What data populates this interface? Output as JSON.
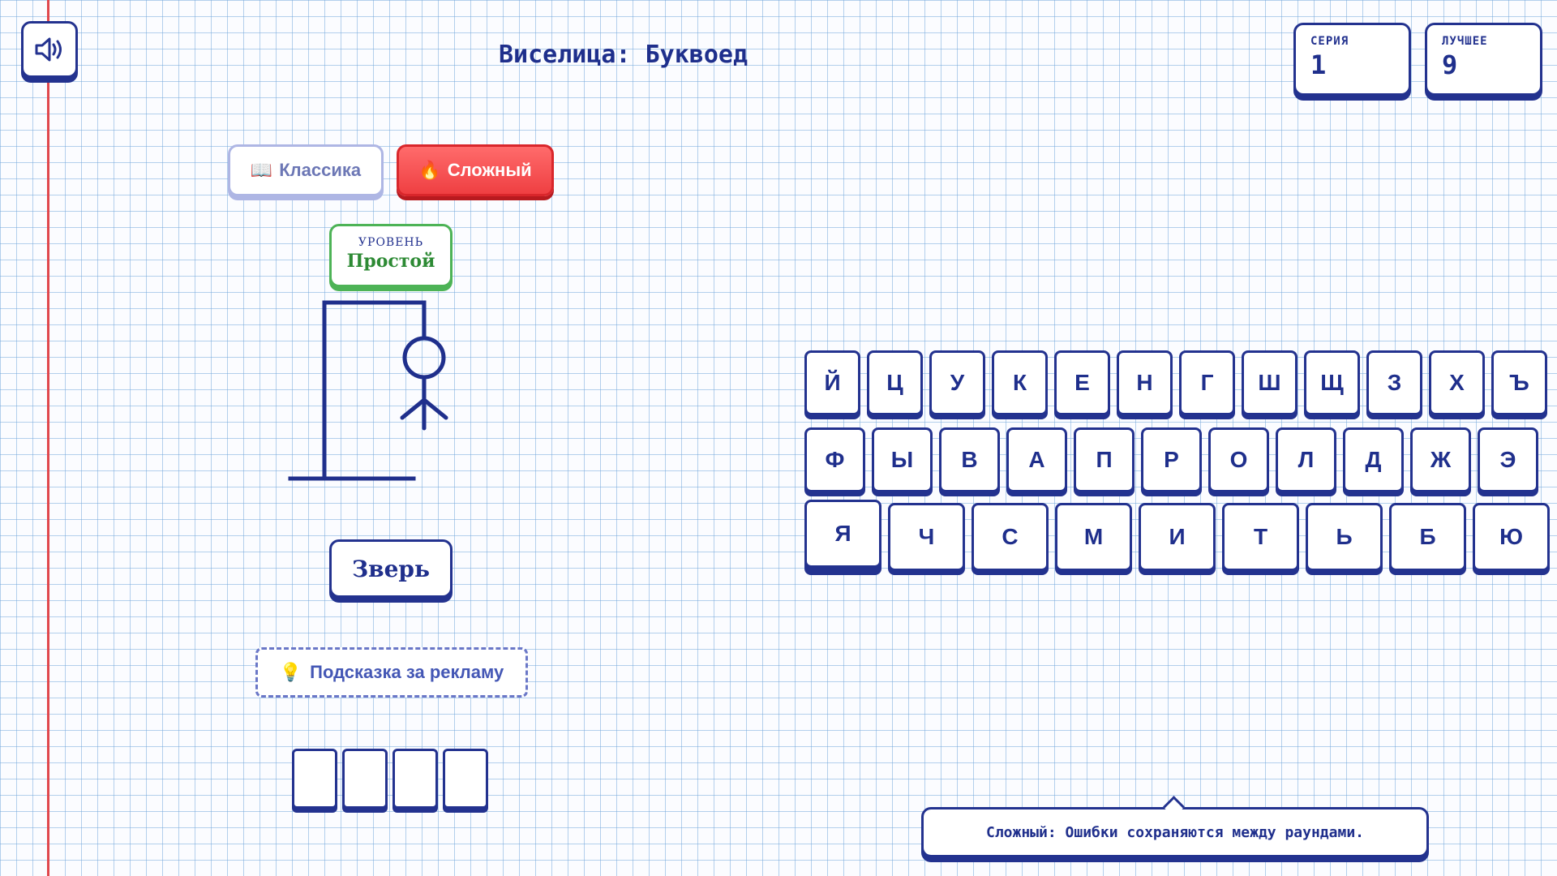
{
  "header": {
    "title": "Виселица: Буквоед",
    "sound_icon": "speaker-icon"
  },
  "stats": {
    "streak_label": "СЕРИЯ",
    "streak_value": "1",
    "best_label": "ЛУЧШЕЕ",
    "best_value": "9"
  },
  "modes": {
    "classic_icon": "📖",
    "classic_label": "Классика",
    "hard_icon": "🔥",
    "hard_label": "Сложный",
    "active": "hard"
  },
  "level": {
    "label": "УРОВЕНЬ",
    "value": "Простой"
  },
  "category": "Зверь",
  "hint": {
    "icon": "💡",
    "label": "Подсказка за рекламу"
  },
  "word_length": 4,
  "keyboard": {
    "row1": [
      "Й",
      "Ц",
      "У",
      "К",
      "Е",
      "Н",
      "Г",
      "Ш",
      "Щ",
      "З",
      "Х",
      "Ъ"
    ],
    "row2": [
      "Ф",
      "Ы",
      "В",
      "А",
      "П",
      "Р",
      "О",
      "Л",
      "Д",
      "Ж",
      "Э"
    ],
    "row3": [
      "Я",
      "Ч",
      "С",
      "М",
      "И",
      "Т",
      "Ь",
      "Б",
      "Ю"
    ]
  },
  "tooltip": "Сложный: Ошибки сохраняются между раундами.",
  "colors": {
    "ink": "#23328f",
    "accent_red": "#ef3f42",
    "level_green": "#2d8a34",
    "margin_line": "#e0474c"
  }
}
